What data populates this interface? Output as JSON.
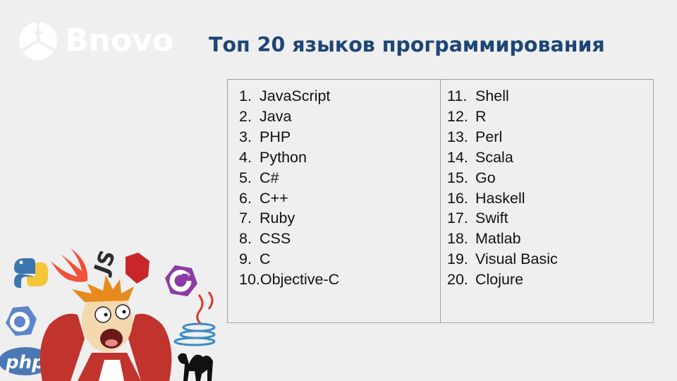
{
  "logo": {
    "text": "Bnovo",
    "icon": "bnovo-logo-icon",
    "color": "#ffffff"
  },
  "title": {
    "text": "Топ 20 языков программирования",
    "color": "#1d4677"
  },
  "list_left": [
    {
      "num": "1.",
      "name": "JavaScript"
    },
    {
      "num": "2.",
      "name": "Java"
    },
    {
      "num": "3.",
      "name": "PHP"
    },
    {
      "num": "4.",
      "name": "Python"
    },
    {
      "num": "5.",
      "name": "C#"
    },
    {
      "num": "6.",
      "name": "C++"
    },
    {
      "num": "7.",
      "name": "Ruby"
    },
    {
      "num": "8.",
      "name": "CSS"
    },
    {
      "num": "9.",
      "name": "C"
    },
    {
      "num": "10.",
      "name": "Objective-C"
    }
  ],
  "list_right": [
    {
      "num": "11.",
      "name": "Shell"
    },
    {
      "num": "12.",
      "name": "R"
    },
    {
      "num": "13.",
      "name": "Perl"
    },
    {
      "num": "14.",
      "name": "Scala"
    },
    {
      "num": "15.",
      "name": "Go"
    },
    {
      "num": "16.",
      "name": "Haskell"
    },
    {
      "num": "17.",
      "name": "Swift"
    },
    {
      "num": "18.",
      "name": "Matlab"
    },
    {
      "num": "19.",
      "name": "Visual Basic"
    },
    {
      "num": "20.",
      "name": "Clojure"
    }
  ],
  "illustration": {
    "description": "Cartoon character clutching head surrounded by language logos",
    "icons": [
      "python-logo-icon",
      "swift-logo-icon",
      "js-logo-icon",
      "ruby-logo-icon",
      "csharp-logo-icon",
      "cpp-logo-icon",
      "java-logo-icon",
      "php-logo-icon",
      "perl-camel-icon"
    ],
    "php_label": "php",
    "js_label": "JS"
  }
}
